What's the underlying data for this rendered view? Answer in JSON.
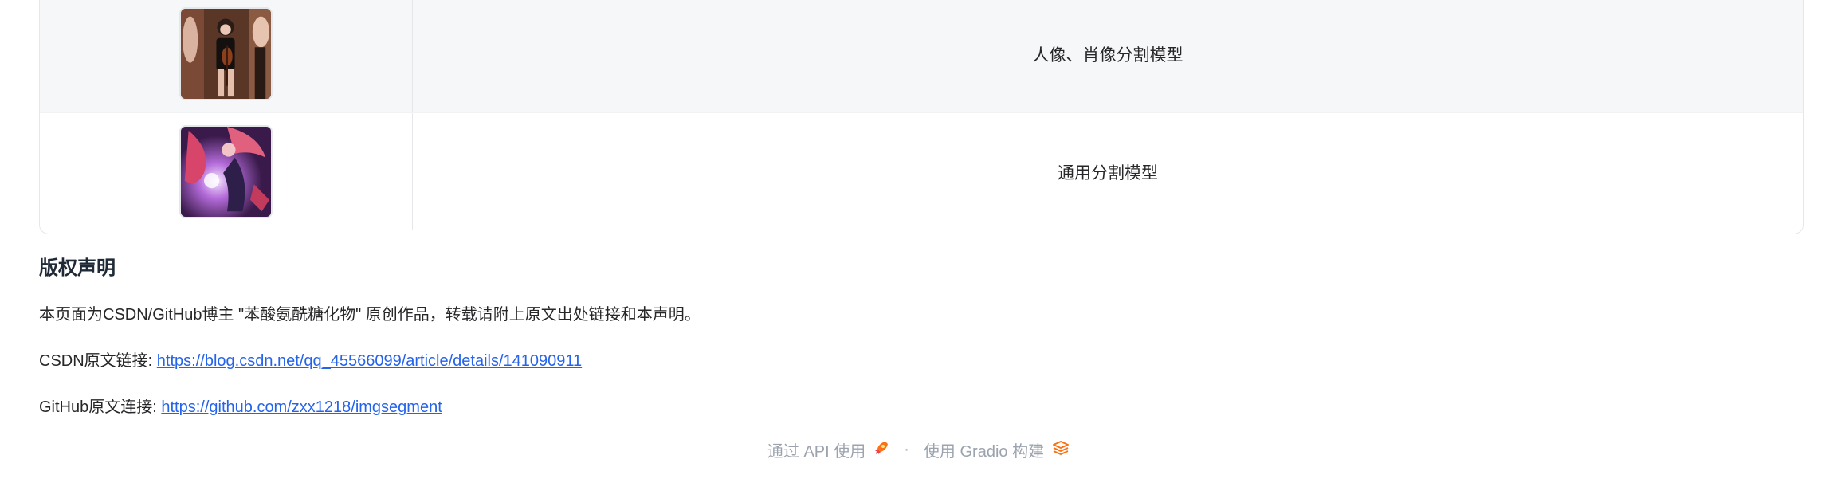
{
  "examples": {
    "rows": [
      {
        "label": "人像、肖像分割模型",
        "thumbnail": "portrait-violin-woman"
      },
      {
        "label": "通用分割模型",
        "thumbnail": "anime-character-art"
      }
    ]
  },
  "copyright": {
    "title": "版权声明",
    "statement": "本页面为CSDN/GitHub博主 \"苯酸氨酰糖化物\" 原创作品，转载请附上原文出处链接和本声明。",
    "csdn_label": "CSDN原文链接: ",
    "csdn_url": "https://blog.csdn.net/qq_45566099/article/details/141090911",
    "github_label": "GitHub原文连接: ",
    "github_url": "https://github.com/zxx1218/imgsegment"
  },
  "footer": {
    "api_label": "通过 API 使用",
    "separator": "·",
    "gradio_label": "使用 Gradio 构建",
    "api_icon": "rocket-icon",
    "gradio_icon": "gradio-logo-icon"
  }
}
